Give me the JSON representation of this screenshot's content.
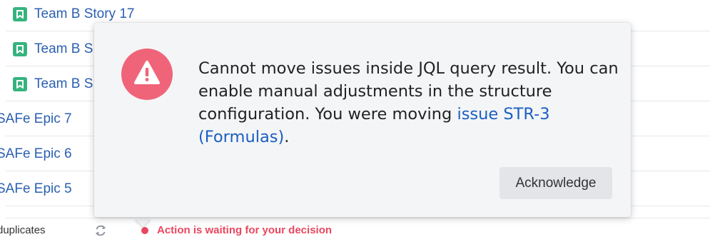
{
  "issues": [
    {
      "type": "story",
      "icon": "story-icon",
      "label": "Team B Story 17"
    },
    {
      "type": "story",
      "icon": "story-icon",
      "label": "Team B S"
    },
    {
      "type": "story",
      "icon": "story-icon",
      "label": "Team B S"
    },
    {
      "type": "epic",
      "label": "SAFe Epic 7"
    },
    {
      "type": "epic",
      "label": "SAFe Epic 6"
    },
    {
      "type": "epic",
      "label": "SAFe Epic 5"
    }
  ],
  "status_bar": {
    "duplicates_label": "duplicates",
    "refresh_icon": "refresh-icon",
    "waiting_text": "Action is waiting for your decision"
  },
  "dialog": {
    "icon": "warning-icon",
    "message_text": "Cannot move issues inside JQL query result. You can enable manual adjustments in the structure configuration. You were moving ",
    "link_text": "issue STR-3 (Formulas)",
    "message_end": ".",
    "button_label": "Acknowledge"
  },
  "colors": {
    "story_icon": "#36b37e",
    "link": "#2a5fb0",
    "alert": "#e9475f",
    "warning_circle": "#f06479",
    "dialog_bg": "#f4f5f7"
  }
}
